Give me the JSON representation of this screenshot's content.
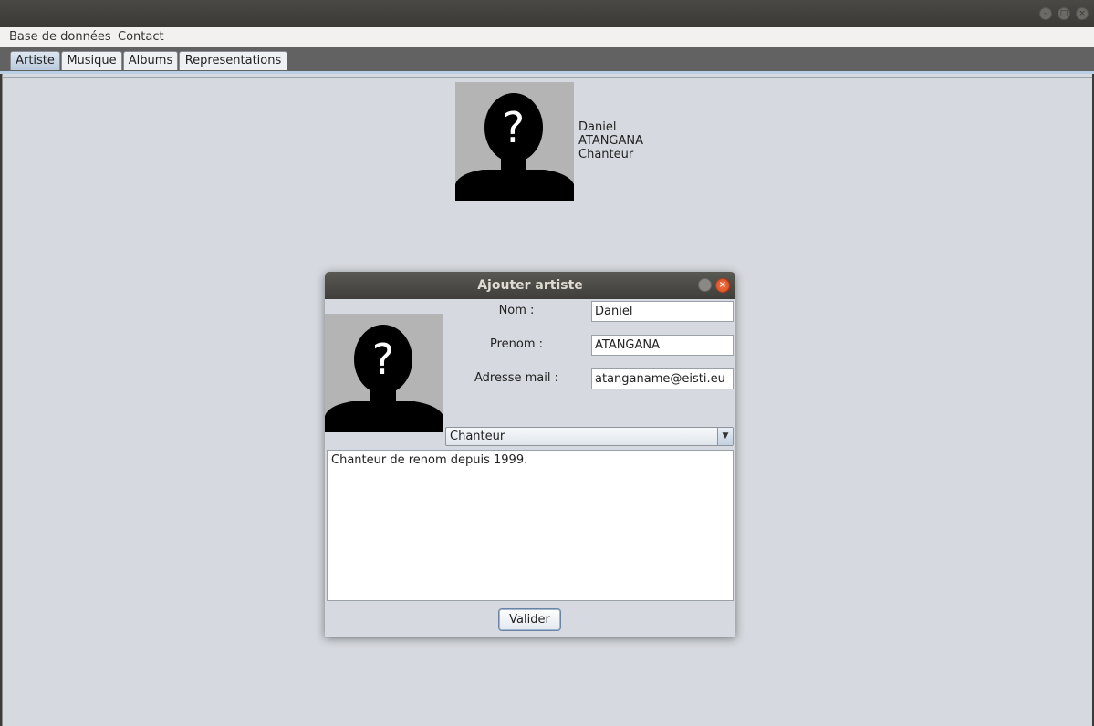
{
  "window": {
    "controls": [
      "minimize-icon",
      "maximize-icon",
      "close-icon"
    ]
  },
  "menubar": {
    "items": [
      "Base de données",
      "Contact"
    ]
  },
  "tabs": [
    {
      "label": "Artiste",
      "active": true
    },
    {
      "label": "Musique",
      "active": false
    },
    {
      "label": "Albums",
      "active": false
    },
    {
      "label": "Representations",
      "active": false
    }
  ],
  "artist_card": {
    "image_icon": "unknown-person-silhouette",
    "first_name": "Daniel",
    "last_name": "ATANGANA",
    "role": "Chanteur"
  },
  "dialog": {
    "title": "Ajouter artiste",
    "image_icon": "unknown-person-silhouette",
    "fields": {
      "nom": {
        "label": "Nom :",
        "value": "Daniel"
      },
      "prenom": {
        "label": "Prenom :",
        "value": "ATANGANA"
      },
      "email": {
        "label": "Adresse mail :",
        "value": "atanganame@eisti.eu"
      }
    },
    "role_select": {
      "value": "Chanteur"
    },
    "description": "Chanteur de renom depuis 1999.",
    "submit_label": "Valider"
  },
  "colors": {
    "titlebar": "#3c3b37",
    "content_background": "#d6d9df",
    "close_button": "#e25b2c",
    "active_tab": "#c8d6e6"
  }
}
